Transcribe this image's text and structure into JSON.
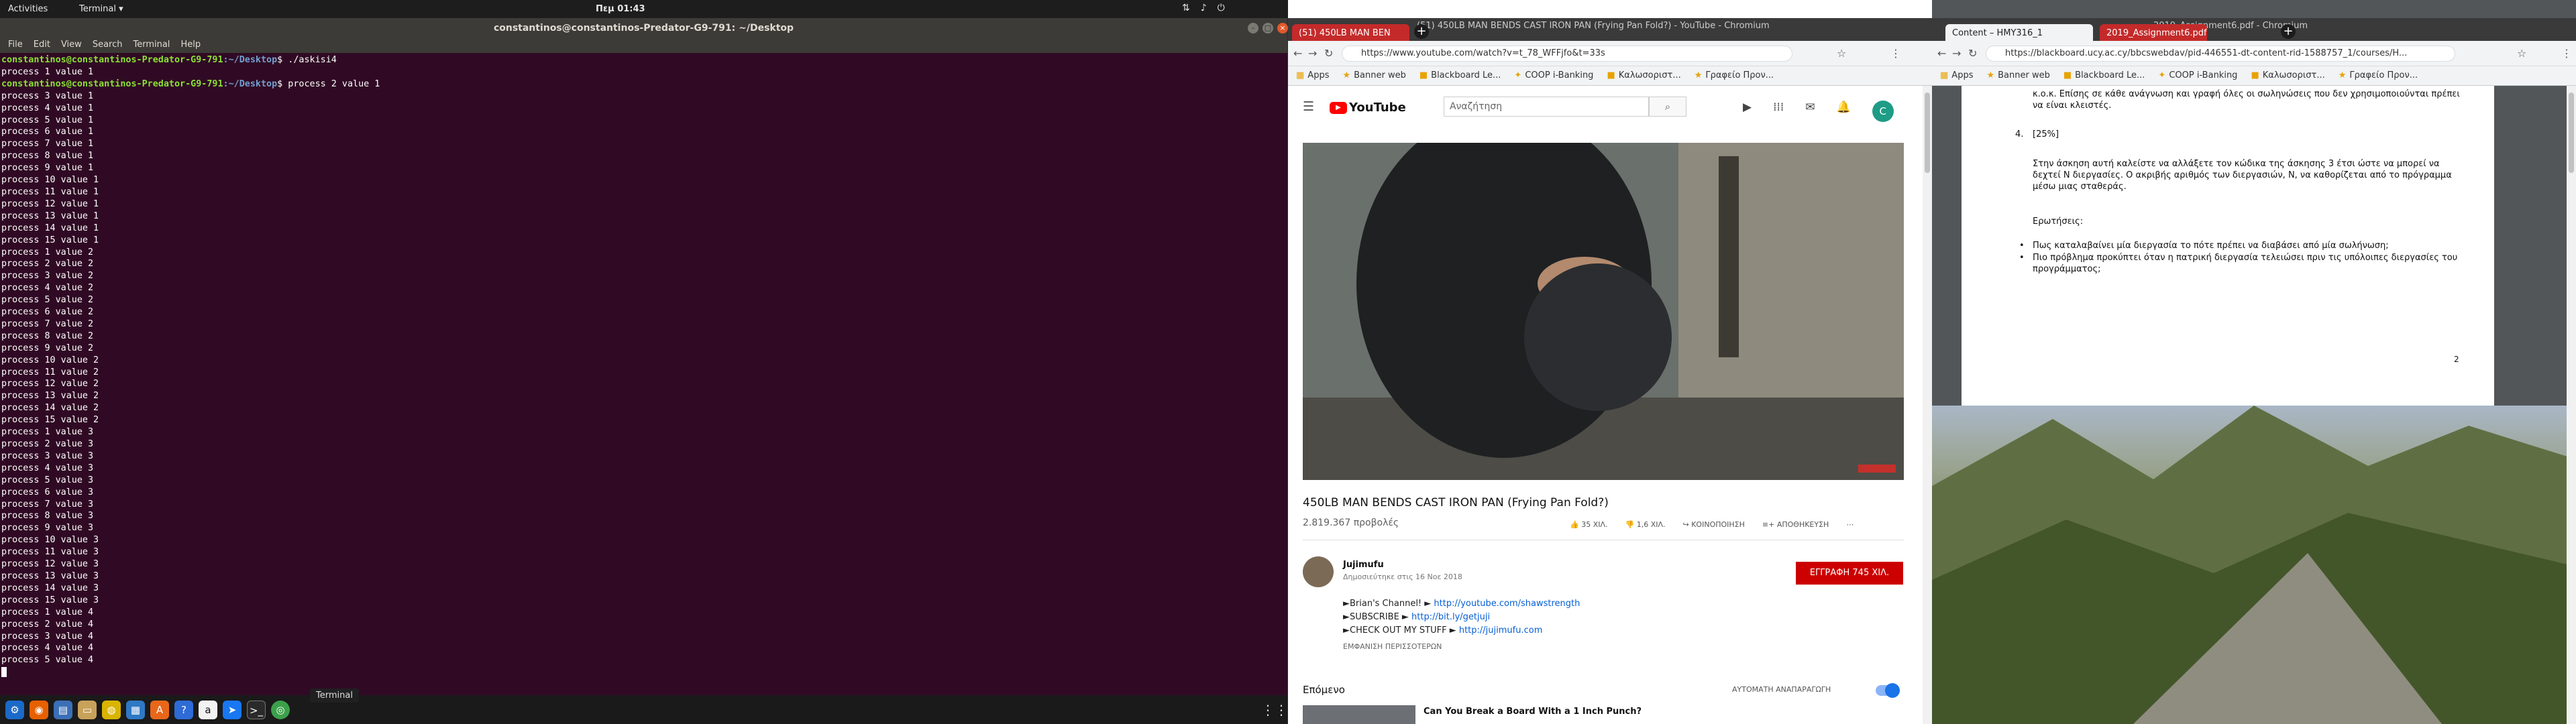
{
  "topbar": {
    "activities": "Activities",
    "app_menu": "Terminal ▾",
    "clock": "Πεμ 01:43"
  },
  "terminal": {
    "title": "constantinos@constantinos-Predator-G9-791: ~/Desktop",
    "menu": [
      "File",
      "Edit",
      "View",
      "Search",
      "Terminal",
      "Help"
    ],
    "prompt_user": "constantinos@constantinos-Predator-G9-791",
    "prompt_path": ":~/Desktop",
    "cmd1": "$ ./askisi4",
    "line_after_cmd1": "process 1 value 1",
    "cmd2": "$ process 2 value 1",
    "output_text": "process 3 value 1\nprocess 4 value 1\nprocess 5 value 1\nprocess 6 value 1\nprocess 7 value 1\nprocess 8 value 1\nprocess 9 value 1\nprocess 10 value 1\nprocess 11 value 1\nprocess 12 value 1\nprocess 13 value 1\nprocess 14 value 1\nprocess 15 value 1\nprocess 1 value 2\nprocess 2 value 2\nprocess 3 value 2\nprocess 4 value 2\nprocess 5 value 2\nprocess 6 value 2\nprocess 7 value 2\nprocess 8 value 2\nprocess 9 value 2\nprocess 10 value 2\nprocess 11 value 2\nprocess 12 value 2\nprocess 13 value 2\nprocess 14 value 2\nprocess 15 value 2\nprocess 1 value 3\nprocess 2 value 3\nprocess 3 value 3\nprocess 4 value 3\nprocess 5 value 3\nprocess 6 value 3\nprocess 7 value 3\nprocess 8 value 3\nprocess 9 value 3\nprocess 10 value 3\nprocess 11 value 3\nprocess 12 value 3\nprocess 13 value 3\nprocess 14 value 3\nprocess 15 value 3\nprocess 1 value 4\nprocess 2 value 4\nprocess 3 value 4\nprocess 4 value 4\nprocess 5 value 4",
    "tooltip": "Terminal"
  },
  "dock": {
    "icons": [
      "settings-icon",
      "firefox-icon",
      "files-icon",
      "folder-icon",
      "rhythmbox-icon",
      "writer-icon",
      "appstore-icon",
      "help-icon",
      "amazon-icon",
      "messenger-icon",
      "terminal-icon",
      "chrome-icon"
    ]
  },
  "youtube_window": {
    "window_title": "(51) 450LB MAN BENDS CAST IRON PAN (Frying Pan Fold?) - YouTube - Chromium",
    "tab_title": "(51) 450LB MAN BEN",
    "url": "https://www.youtube.com/watch?v=t_78_WFFjfo&t=33s",
    "bookmarks": [
      "Apps",
      "Banner web",
      "Blackboard Le...",
      "COOP i-Banking",
      "Καλωσοριστ...",
      "Γραφείο Προν..."
    ],
    "search_placeholder": "Αναζήτηση",
    "video_title": "450LB MAN BENDS CAST IRON PAN (Frying Pan Fold?)",
    "views": "2.819.367 προβολές",
    "likes": "35 ΧΙΛ.",
    "dislikes": "1,6 ΧΙΛ.",
    "share": "ΚΟΙΝΟΠΟΙΗΣΗ",
    "save": "ΑΠΟΘΗΚΕΥΣΗ",
    "channel_name": "Jujimufu",
    "published": "Δημοσιεύτηκε στις 16 Νοε 2018",
    "subscribe": "ΕΓΓΡΑΦΗ  745 ΧΙΛ.",
    "desc1_prefix": "►Brian's Channel! ► ",
    "desc1_link": "http://youtube.com/shawstrength",
    "desc2_prefix": "►SUBSCRIBE ► ",
    "desc2_link": "http://bit.ly/getjuji",
    "desc3_prefix": "►CHECK OUT MY STUFF ► ",
    "desc3_link": "http://jujimufu.com",
    "show_more": "ΕΜΦΑΝΙΣΗ ΠΕΡΙΣΣΟΤΕΡΩΝ",
    "up_next": "Επόμενο",
    "autoplay": "ΑΥΤΟΜΑΤΗ ΑΝΑΠΑΡΑΓΩΓΗ",
    "next_video_title": "Can You Break a Board With a 1 Inch Punch?"
  },
  "pdf_window": {
    "window_title": "2019_Assignment6.pdf - Chromium",
    "tab1": "Content – HMY316_1",
    "tab2": "2019_Assignment6.pdf",
    "url": "https://blackboard.ucy.ac.cy/bbcswebdav/pid-446551-dt-content-rid-1588757_1/courses/H...",
    "bookmarks": [
      "Apps",
      "Banner web",
      "Blackboard Le...",
      "COOP i-Banking",
      "Καλωσοριστ...",
      "Γραφείο Προν..."
    ],
    "line_top": "κ.ο.κ. Επίσης σε κάθε ανάγνωση και γραφή όλες οι σωληνώσεις που δεν χρησιμοποιούνται πρέπει να είναι κλειστές.",
    "item_num": "4.",
    "item_pct": "[25%]",
    "para": "Στην άσκηση αυτή καλείστε να αλλάξετε τον κώδικα της άσκησης 3 έτσι ώστε να μπορεί να δεχτεί Ν διεργασίες. Ο ακριβής αριθμός των διεργασιών, Ν, να καθορίζεται από το πρόγραμμα μέσω μιας σταθεράς.",
    "questions": "Ερωτήσεις:",
    "q1": "Πως καταλαβαίνει μία διεργασία το πότε πρέπει να διαβάσει από μία σωλήνωση;",
    "q2": "Πιο πρόβλημα προκύπτει όταν η πατρική διεργασία τελειώσει πριν τις υπόλοιπες διεργασίες του προγράμματος;",
    "page_number": "2"
  }
}
